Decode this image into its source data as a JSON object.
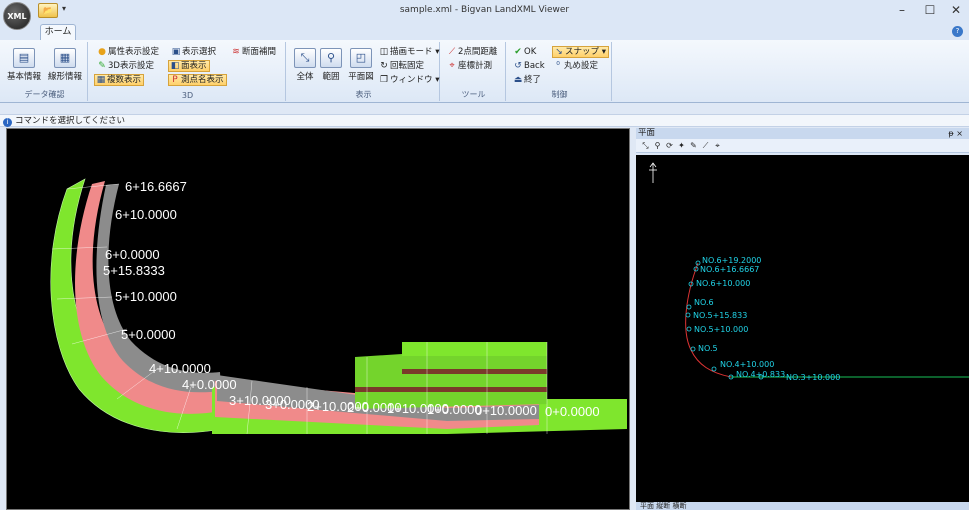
{
  "window": {
    "title": "sample.xml - Bigvan LandXML Viewer",
    "app_logo": "XML",
    "minimize": "–",
    "maximize": "☐",
    "close": "✕",
    "help": "?"
  },
  "tabs": {
    "home": "ホーム"
  },
  "ribbon": {
    "data_group": {
      "label": "データ確認",
      "basic_info": "基本情報",
      "alignment_info": "線形情報"
    },
    "group3d": {
      "label": "3D",
      "attr_setting": "属性表示設定",
      "show_select": "表示選択",
      "section_interp": "断面補間",
      "display_3d": "3D表示設定",
      "surface": "面表示",
      "multi": "複数表示",
      "point_name": "測点名表示"
    },
    "display_group": {
      "label": "表示",
      "all": "全体",
      "range": "範囲",
      "plan": "平面図",
      "draw_mode": "描画モード",
      "rotation_fix": "回転固定",
      "window": "ウィンドウ"
    },
    "tools_group": {
      "label": "ツール",
      "distance": "2点間距離",
      "coord": "座標計測"
    },
    "control_group": {
      "label": "制御",
      "ok": "OK",
      "back": "Back",
      "end": "終了",
      "snap": "スナップ",
      "round": "丸め設定"
    }
  },
  "status": {
    "message": "コマンドを選択してください"
  },
  "plan_panel": {
    "title": "平面",
    "pin": "ᵽ ×",
    "footer": "平面 縦断 横断"
  },
  "view3d_labels": [
    "6+16.6667",
    "6+10.0000",
    "6+0.0000",
    "5+15.8333",
    "5+10.0000",
    "5+0.0000",
    "4+10.0000",
    "4+0.0000",
    "3+10.0000",
    "3+0.0000",
    "2+10.0000",
    "2+0.0000",
    "1+10.0000",
    "1+0.0000",
    "0+10.0000",
    "0+0.0000"
  ],
  "plan_labels": [
    "NO.6+19.2000",
    "NO.6+16.6667",
    "NO.6+10.000",
    "NO.6",
    "NO.5+15.833",
    "NO.5+10.000",
    "NO.5",
    "NO.4+10.000",
    "NO.4+0.833",
    "NO.3+10.000"
  ],
  "colors": {
    "grass": "#7fe62d",
    "shoulder": "#f08a8a",
    "pavement": "#8c8c8c",
    "plan_line": "#d33",
    "plan_text": "#21d4e8"
  }
}
